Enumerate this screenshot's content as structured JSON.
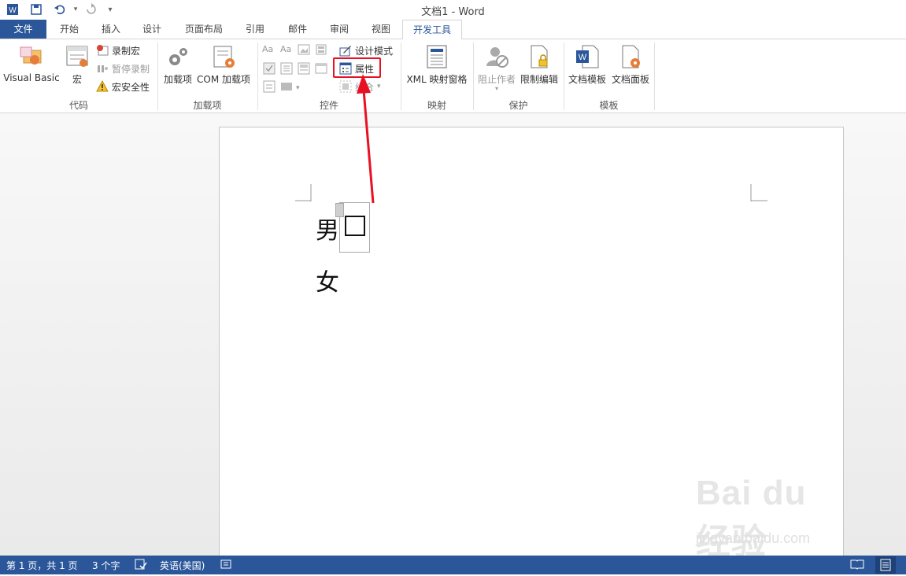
{
  "window": {
    "title": "文档1 - Word"
  },
  "qat": {
    "undo_icon": "undo-icon",
    "redo_icon": "redo-icon",
    "save_icon": "save-icon"
  },
  "tabs": [
    "文件",
    "开始",
    "插入",
    "设计",
    "页面布局",
    "引用",
    "邮件",
    "审阅",
    "视图",
    "开发工具"
  ],
  "ribbon": {
    "code": {
      "label": "代码",
      "visual_basic": "Visual Basic",
      "macros": "宏",
      "record_macro": "录制宏",
      "pause_recording": "暂停录制",
      "macro_security": "宏安全性"
    },
    "addins": {
      "label": "加载项",
      "addins": "加载项",
      "com_addins": "COM 加载项"
    },
    "controls": {
      "label": "控件",
      "design_mode": "设计模式",
      "properties": "属性",
      "group": "组合"
    },
    "mapping": {
      "label": "映射",
      "xml_pane": "XML 映射窗格"
    },
    "protect": {
      "label": "保护",
      "block_authors": "阻止作者",
      "restrict_editing": "限制编辑"
    },
    "templates": {
      "label": "模板",
      "document_template": "文档模板",
      "document_panel": "文档面板"
    }
  },
  "document": {
    "line1": "男",
    "line2": "女"
  },
  "status": {
    "page": "第 1 页，共 1 页",
    "words": "3 个字",
    "language": "英语(美国)"
  },
  "watermark": {
    "text": "Bai du 经验",
    "url": "jingyan.baidu.com"
  },
  "colors": {
    "accent": "#2b579a",
    "highlight": "#e81123"
  }
}
